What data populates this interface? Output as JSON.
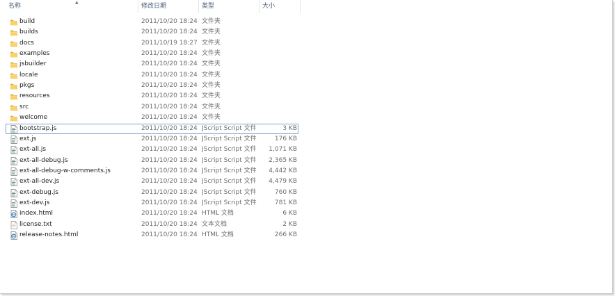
{
  "columns": {
    "name": "名称",
    "date": "修改日期",
    "type": "类型",
    "size": "大小"
  },
  "colors": {
    "header_text": "#4c607a",
    "focus_border": "#7da2ce",
    "folder": "#f2c94c"
  },
  "files": [
    {
      "name": "build",
      "date": "2011/10/20 18:24",
      "type": "文件夹",
      "size": "",
      "icon": "folder-icon"
    },
    {
      "name": "builds",
      "date": "2011/10/20 18:24",
      "type": "文件夹",
      "size": "",
      "icon": "folder-icon"
    },
    {
      "name": "docs",
      "date": "2011/10/19 18:27",
      "type": "文件夹",
      "size": "",
      "icon": "folder-icon"
    },
    {
      "name": "examples",
      "date": "2011/10/20 18:24",
      "type": "文件夹",
      "size": "",
      "icon": "folder-icon"
    },
    {
      "name": "jsbuilder",
      "date": "2011/10/20 18:24",
      "type": "文件夹",
      "size": "",
      "icon": "folder-icon"
    },
    {
      "name": "locale",
      "date": "2011/10/20 18:24",
      "type": "文件夹",
      "size": "",
      "icon": "folder-icon"
    },
    {
      "name": "pkgs",
      "date": "2011/10/20 18:24",
      "type": "文件夹",
      "size": "",
      "icon": "folder-icon"
    },
    {
      "name": "resources",
      "date": "2011/10/20 18:24",
      "type": "文件夹",
      "size": "",
      "icon": "folder-icon"
    },
    {
      "name": "src",
      "date": "2011/10/20 18:24",
      "type": "文件夹",
      "size": "",
      "icon": "folder-icon"
    },
    {
      "name": "welcome",
      "date": "2011/10/20 18:24",
      "type": "文件夹",
      "size": "",
      "icon": "folder-icon"
    },
    {
      "name": "bootstrap.js",
      "date": "2011/10/20 18:24",
      "type": "JScript Script 文件",
      "size": "3 KB",
      "icon": "script-file-icon",
      "focused": true
    },
    {
      "name": "ext.js",
      "date": "2011/10/20 18:24",
      "type": "JScript Script 文件",
      "size": "176 KB",
      "icon": "script-file-icon"
    },
    {
      "name": "ext-all.js",
      "date": "2011/10/20 18:24",
      "type": "JScript Script 文件",
      "size": "1,071 KB",
      "icon": "script-file-icon"
    },
    {
      "name": "ext-all-debug.js",
      "date": "2011/10/20 18:24",
      "type": "JScript Script 文件",
      "size": "2,365 KB",
      "icon": "script-file-icon"
    },
    {
      "name": "ext-all-debug-w-comments.js",
      "date": "2011/10/20 18:24",
      "type": "JScript Script 文件",
      "size": "4,442 KB",
      "icon": "script-file-icon"
    },
    {
      "name": "ext-all-dev.js",
      "date": "2011/10/20 18:24",
      "type": "JScript Script 文件",
      "size": "4,479 KB",
      "icon": "script-file-icon"
    },
    {
      "name": "ext-debug.js",
      "date": "2011/10/20 18:24",
      "type": "JScript Script 文件",
      "size": "760 KB",
      "icon": "script-file-icon"
    },
    {
      "name": "ext-dev.js",
      "date": "2011/10/20 18:24",
      "type": "JScript Script 文件",
      "size": "781 KB",
      "icon": "script-file-icon"
    },
    {
      "name": "index.html",
      "date": "2011/10/20 18:24",
      "type": "HTML 文档",
      "size": "6 KB",
      "icon": "html-file-icon"
    },
    {
      "name": "license.txt",
      "date": "2011/10/20 18:24",
      "type": "文本文档",
      "size": "2 KB",
      "icon": "text-file-icon"
    },
    {
      "name": "release-notes.html",
      "date": "2011/10/20 18:24",
      "type": "HTML 文档",
      "size": "266 KB",
      "icon": "html-file-icon"
    }
  ]
}
